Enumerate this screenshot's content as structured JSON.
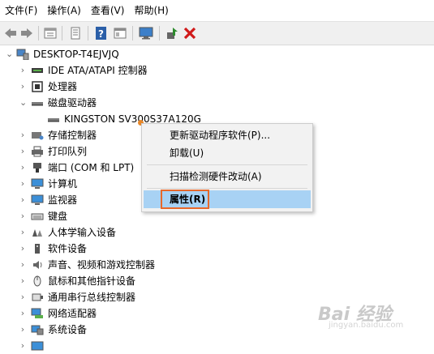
{
  "menubar": {
    "items": [
      "文件(F)",
      "操作(A)",
      "查看(V)",
      "帮助(H)"
    ]
  },
  "toolbar": {
    "buttons": [
      "back-icon",
      "forward-icon",
      "properties-icon",
      "list-icon",
      "help-icon",
      "view-icon",
      "monitor-icon",
      "update-driver-icon",
      "uninstall-icon"
    ],
    "accent_green": "#2e8b2e",
    "accent_red": "#d01a1a",
    "accent_blue": "#2b5fa8"
  },
  "tree": {
    "root": "DESKTOP-T4EJVJQ",
    "items": [
      "IDE ATA/ATAPI 控制器",
      "处理器",
      "磁盘驱动器",
      "KINGSTON SV300S37A120G",
      "存储控制器",
      "打印队列",
      "端口 (COM 和 LPT)",
      "计算机",
      "监视器",
      "键盘",
      "人体学输入设备",
      "软件设备",
      "声音、视频和游戏控制器",
      "鼠标和其他指针设备",
      "通用串行总线控制器",
      "网络适配器",
      "系统设备"
    ]
  },
  "context_menu": {
    "update_driver": "更新驱动程序软件(P)...",
    "uninstall": "卸载(U)",
    "scan": "扫描检测硬件改动(A)",
    "properties": "属性(R)",
    "highlight_color": "#a8d2f4",
    "box_color": "#e8682a"
  },
  "watermark": {
    "logo": "Bai 经验",
    "url": "jingyan.baidu.com"
  }
}
